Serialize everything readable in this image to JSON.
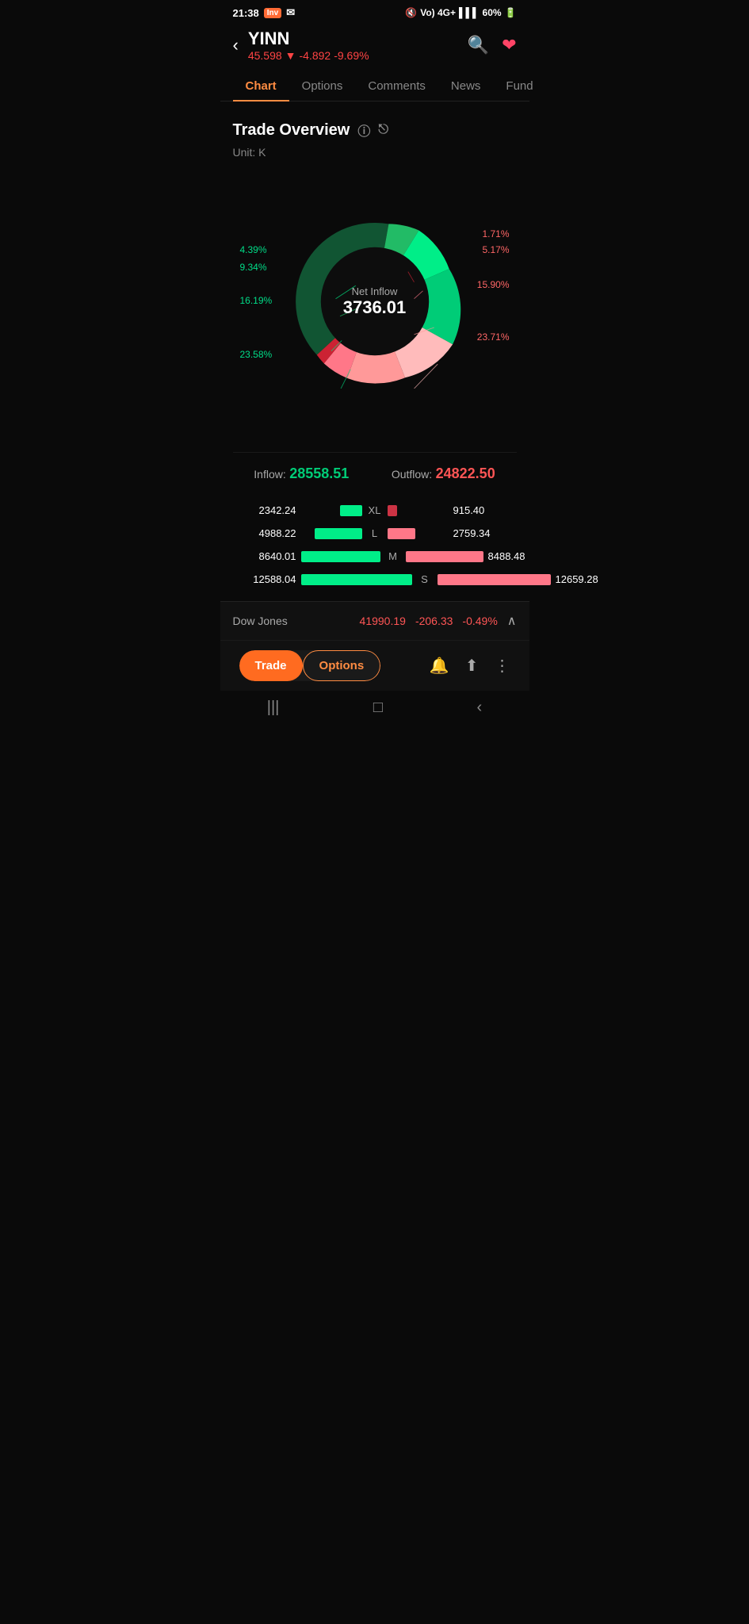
{
  "statusBar": {
    "time": "21:38",
    "badge": "Inv",
    "battery": "60%"
  },
  "header": {
    "ticker": "YINN",
    "price": "45.598",
    "change": "-4.892",
    "changePercent": "-9.69%",
    "backLabel": "‹"
  },
  "tabs": {
    "items": [
      {
        "label": "Chart",
        "active": true
      },
      {
        "label": "Options",
        "active": false
      },
      {
        "label": "Comments",
        "active": false
      },
      {
        "label": "News",
        "active": false
      },
      {
        "label": "Fund",
        "active": false
      }
    ]
  },
  "tradeOverview": {
    "title": "Trade Overview",
    "unit": "Unit: K",
    "netInflowLabel": "Net Inflow",
    "netInflowValue": "3736.01",
    "donut": {
      "segments": [
        {
          "pct": 1.71,
          "color": "#cc2233",
          "side": "right",
          "top": true
        },
        {
          "pct": 5.17,
          "color": "#ff7788",
          "side": "right",
          "top": true
        },
        {
          "pct": 15.9,
          "color": "#ff9999",
          "side": "right"
        },
        {
          "pct": 23.71,
          "color": "#ffbbbb",
          "side": "right"
        },
        {
          "pct": 23.58,
          "color": "#00cc77",
          "side": "left"
        },
        {
          "pct": 16.19,
          "color": "#00ee88",
          "side": "left"
        },
        {
          "pct": 9.34,
          "color": "#22bb66",
          "side": "left",
          "top": true
        },
        {
          "pct": 4.39,
          "color": "#115533",
          "side": "left",
          "top": true
        }
      ],
      "labels": {
        "leftTop1": "4.39%",
        "leftTop2": "9.34%",
        "leftMid": "16.19%",
        "leftBottom": "23.58%",
        "rightTop1": "1.71%",
        "rightTop2": "5.17%",
        "rightMid": "15.90%",
        "rightBottom": "23.71%"
      }
    },
    "inflow": {
      "label": "Inflow:",
      "value": "28558.51"
    },
    "outflow": {
      "label": "Outflow:",
      "value": "24822.50"
    },
    "bars": [
      {
        "size": "XL",
        "inflowVal": "2342.24",
        "outflowVal": "915.40",
        "inflowWidth": 28,
        "outflowWidth": 12,
        "outflowDark": true
      },
      {
        "size": "L",
        "inflowVal": "4988.22",
        "outflowVal": "2759.34",
        "inflowWidth": 60,
        "outflowWidth": 35
      },
      {
        "size": "M",
        "inflowVal": "8640.01",
        "outflowVal": "8488.48",
        "inflowWidth": 100,
        "outflowWidth": 98
      },
      {
        "size": "S",
        "inflowVal": "12588.04",
        "outflowVal": "12659.28",
        "inflowWidth": 145,
        "outflowWidth": 148
      }
    ]
  },
  "bottomTicker": {
    "name": "Dow Jones",
    "chart": "chart",
    "value": "41990.19",
    "change": "-206.33",
    "changePercent": "-0.49%"
  },
  "bottomNav": {
    "tradeLabel": "Trade",
    "optionsLabel": "Options"
  },
  "systemNav": {
    "items": [
      "|||",
      "□",
      "‹"
    ]
  }
}
